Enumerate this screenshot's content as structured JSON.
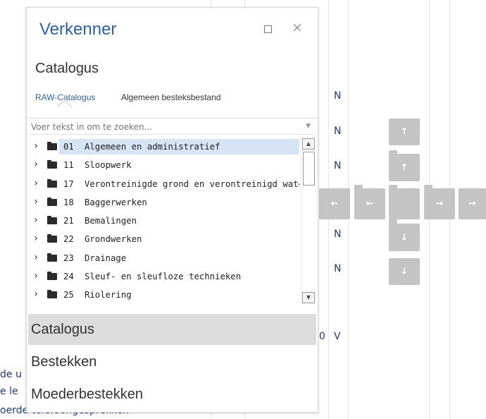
{
  "panel": {
    "title": "Verkenner",
    "maximize_icon": "maximize-icon",
    "close_icon": "close-icon",
    "close_glyph": "×",
    "section_title": "Catalogus",
    "tabs": [
      {
        "label": "RAW-Catalogus",
        "active": true
      },
      {
        "label": "Algemeen besteksbestand",
        "active": false
      }
    ],
    "search": {
      "placeholder": "Voer tekst in om te zoeken...",
      "value": ""
    },
    "tree": [
      {
        "code": "01",
        "label": "Algemeen en administratief",
        "selected": true
      },
      {
        "code": "11",
        "label": "Sloopwerk",
        "selected": false
      },
      {
        "code": "17",
        "label": "Verontreinigde grond en verontreinigd water",
        "selected": false
      },
      {
        "code": "18",
        "label": "Baggerwerken",
        "selected": false
      },
      {
        "code": "21",
        "label": "Bemalingen",
        "selected": false
      },
      {
        "code": "22",
        "label": "Grondwerken",
        "selected": false
      },
      {
        "code": "23",
        "label": "Drainage",
        "selected": false
      },
      {
        "code": "24",
        "label": "Sleuf- en sleufloze technieken",
        "selected": false
      },
      {
        "code": "25",
        "label": "Riolering",
        "selected": false
      }
    ],
    "accordion": [
      {
        "label": "Catalogus",
        "active": true
      },
      {
        "label": "Bestekken",
        "active": false
      },
      {
        "label": "Moederbestekken",
        "active": false
      }
    ]
  },
  "background": {
    "column_letters": [
      "N",
      "N",
      "N",
      "N",
      "N",
      "N",
      "V"
    ],
    "zero": "0",
    "left_fragments": [
      "de u",
      "e le",
      "oerde telefoongesprekken"
    ]
  },
  "dock_guides": {
    "arrow_up": "↑",
    "arrow_down": "↓",
    "arrow_left": "←",
    "arrow_right": "→"
  }
}
